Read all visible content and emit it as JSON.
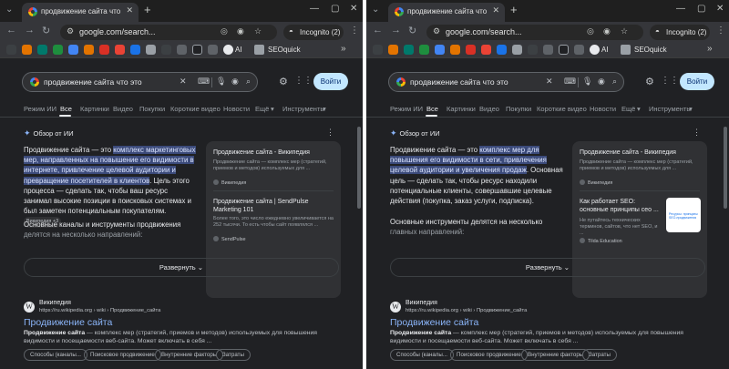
{
  "windows": [
    {
      "tab_title": "продвижение сайта что это",
      "url": "google.com/search...",
      "incognito_label": "Incognito (2)",
      "bookmark_ai": "AI",
      "bookmark_seo": "SEOquick",
      "search": {
        "query": "продвижение сайта что это",
        "sign_in": "Войти",
        "tabs": [
          "Режим ИИ",
          "Все",
          "Картинки",
          "Видео",
          "Покупки",
          "Короткие видео",
          "Новости",
          "Ещё",
          "Инструменты"
        ]
      },
      "aio": {
        "heading": "Обзор от ИИ",
        "p1_lead": "Продвижение сайта — это ",
        "p1_highlight": "комплекс маркетинговых мер, направленных на повышение его видимости в интернете, привлечение целевой аудитории и превращение посетителей в клиентов",
        "p1_tail": ". Цель этого процесса — сделать так, чтобы ваш ресурс занимал высокие позиции в поисковых системах и был заметен потенциальным покупателям.",
        "p1_chip": "Википедия +3",
        "p2": "Основные каналы и инструменты продвижения",
        "p2_fade": "делятся на несколько направлений:",
        "cards": [
          {
            "title": "Продвижение сайта - Википедия",
            "snippet": "Продвижение сайта — комплекс мер (стратегий, приемов и методов) используемых для ...",
            "source": "Википедия"
          },
          {
            "title": "Продвижение сайта | SendPulse Marketing 101",
            "snippet": "Более того, это число ежедневно увеличивается на 252 тысячи. То есть чтобы сайт появлялся ...",
            "source": "SendPulse"
          }
        ],
        "expand": "Развернуть"
      },
      "result": {
        "site": "Википедия",
        "url": "https://ru.wikipedia.org › wiki › Продвижение_сайта",
        "title": "Продвижение сайта",
        "snippet_bold": "Продвижение сайта",
        "snippet": " — комплекс мер (стратегий, приемов и методов) используемых для повышения видимости и посещаемости веб-сайта. Может включать в себя ...",
        "pills": [
          "Способы (каналы...",
          "Поисковое продвижение",
          "Внутренние факторы",
          "Затраты"
        ]
      }
    },
    {
      "tab_title": "продвижение сайта что это",
      "url": "google.com/search...",
      "incognito_label": "Incognito (2)",
      "bookmark_ai": "AI",
      "bookmark_seo": "SEOquick",
      "search": {
        "query": "продвижение сайта что это",
        "sign_in": "Войти",
        "tabs": [
          "Режим ИИ",
          "Все",
          "Картинки",
          "Видео",
          "Покупки",
          "Короткие видео",
          "Новости",
          "Ещё",
          "Инструменты"
        ]
      },
      "aio": {
        "heading": "Обзор от ИИ",
        "p1_lead": "Продвижение сайта — это ",
        "p1_highlight": "комплекс мер для повышения его видимости в сети, привлечения целевой аудитории и увеличения продаж",
        "p1_tail": ". Основная цель — сделать так, чтобы ресурс находили потенциальные клиенты, совершавшие целевые действия (покупка, заказ услуги, подписка).",
        "p1_chip": "",
        "p2": "Основные инструменты делятся на несколько",
        "p2_fade": "главных направлений:",
        "cards": [
          {
            "title": "Продвижение сайта - Википедия",
            "snippet": "Продвижение сайта — комплекс мер (стратегий, приемов и методов) используемых для ...",
            "source": "Википедия"
          },
          {
            "title": "Как работает SEO: основные принципы сео ...",
            "snippet": "Не путайтесь технических терминов, сайтов, что нет SEO, и ...",
            "source": "Tilda Education"
          }
        ],
        "thumb_text": "Ресурсы: принципы SEO-продвижения",
        "expand": "Развернуть"
      },
      "result": {
        "site": "Википедия",
        "url": "https://ru.wikipedia.org › wiki › Продвижение_сайта",
        "title": "Продвижение сайта",
        "snippet_bold": "Продвижение сайта",
        "snippet": " — комплекс мер (стратегий, приемов и методов) используемых для повышения видимости и посещаемости веб-сайта. Может включать в себя ...",
        "pills": [
          "Способы (каналы...",
          "Поисковое продвижение",
          "Внутренние факторы",
          "Затраты"
        ]
      }
    }
  ]
}
